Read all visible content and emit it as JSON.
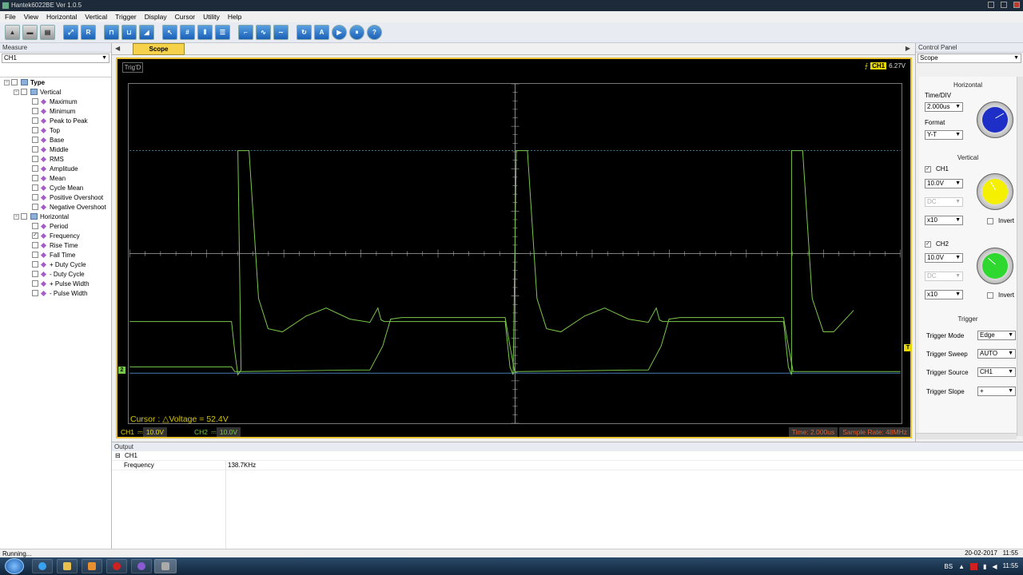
{
  "window": {
    "title": "Hantek6022BE Ver 1.0.5"
  },
  "menu": [
    "File",
    "View",
    "Horizontal",
    "Vertical",
    "Trigger",
    "Display",
    "Cursor",
    "Utility",
    "Help"
  ],
  "toolbar": {
    "buttons": [
      {
        "name": "open-icon",
        "glyph": "▲",
        "style": "grey"
      },
      {
        "name": "save-icon",
        "glyph": "▬",
        "style": "grey"
      },
      {
        "name": "print-icon",
        "glyph": "▤",
        "style": "grey"
      },
      {
        "sep": true
      },
      {
        "name": "auto-scale-icon",
        "glyph": "⤢"
      },
      {
        "name": "reset-icon",
        "glyph": "R"
      },
      {
        "sep": true
      },
      {
        "name": "single-trigger-icon",
        "glyph": "⊓"
      },
      {
        "name": "normal-trigger-icon",
        "glyph": "⊔"
      },
      {
        "name": "ramp-icon",
        "glyph": "◢"
      },
      {
        "sep": true
      },
      {
        "name": "cursor-select-icon",
        "glyph": "↖"
      },
      {
        "name": "grid-icon",
        "glyph": "#"
      },
      {
        "name": "vertical-cursor-icon",
        "glyph": "⫴"
      },
      {
        "name": "horizontal-cursor-icon",
        "glyph": "☰"
      },
      {
        "sep": true
      },
      {
        "name": "edge-trigger-icon",
        "glyph": "⌐"
      },
      {
        "name": "signal-icon",
        "glyph": "∿"
      },
      {
        "name": "sine-icon",
        "glyph": "∼"
      },
      {
        "sep": true
      },
      {
        "name": "refresh-icon",
        "glyph": "↻"
      },
      {
        "name": "auto-icon",
        "glyph": "A"
      },
      {
        "name": "play-icon",
        "glyph": "▶",
        "style": "round"
      },
      {
        "name": "pause-icon",
        "glyph": "⏸",
        "style": "round"
      },
      {
        "name": "help-icon",
        "glyph": "?",
        "style": "round"
      }
    ]
  },
  "measure": {
    "title": "Measure",
    "channel": "CH1",
    "tree_root": "Type",
    "groups": [
      {
        "label": "Vertical",
        "items": [
          {
            "label": "Maximum",
            "checked": false
          },
          {
            "label": "Minimum",
            "checked": false
          },
          {
            "label": "Peak to Peak",
            "checked": false
          },
          {
            "label": "Top",
            "checked": false
          },
          {
            "label": "Base",
            "checked": false
          },
          {
            "label": "Middle",
            "checked": false
          },
          {
            "label": "RMS",
            "checked": false
          },
          {
            "label": "Amplitude",
            "checked": false
          },
          {
            "label": "Mean",
            "checked": false
          },
          {
            "label": "Cycle Mean",
            "checked": false
          },
          {
            "label": "Positive Overshoot",
            "checked": false
          },
          {
            "label": "Negative Overshoot",
            "checked": false
          }
        ]
      },
      {
        "label": "Horizontal",
        "items": [
          {
            "label": "Period",
            "checked": false
          },
          {
            "label": "Frequency",
            "checked": true
          },
          {
            "label": "Rise Time",
            "checked": false
          },
          {
            "label": "Fall Time",
            "checked": false
          },
          {
            "label": "+ Duty Cycle",
            "checked": false
          },
          {
            "label": "- Duty Cycle",
            "checked": false
          },
          {
            "label": "+ Pulse Width",
            "checked": false
          },
          {
            "label": "- Pulse Width",
            "checked": false
          }
        ]
      }
    ]
  },
  "scope": {
    "tab": "Scope",
    "trig_status": "Trig'D",
    "trig_channel": "CH1",
    "trig_level": "6.27V",
    "cursor_text": "Cursor : △Voltage = 52.4V",
    "ch1_label": "CH1",
    "ch1_scale": "10.0V",
    "ch2_label": "CH2",
    "ch2_scale": "10.0V",
    "time_text": "Time: 2.000us",
    "sample_rate": "Sample Rate: 48MHz",
    "ch2_marker": "2",
    "trigger_marker": "T",
    "colors": {
      "ch1": "#d8d800",
      "ch2": "#5fc04a",
      "ch2_ref": "#4a7ab8",
      "frame": "#e8c030"
    }
  },
  "control": {
    "title": "Control Panel",
    "mode": "Scope",
    "horizontal": {
      "section": "Horizontal",
      "time_label": "Time/DIV",
      "time_value": "2.000us",
      "format_label": "Format",
      "format_value": "Y-T"
    },
    "vertical": {
      "section": "Vertical",
      "ch1": {
        "label": "CH1",
        "enabled": true,
        "volts": "10.0V",
        "coupling": "DC",
        "probe": "x10",
        "invert": "Invert"
      },
      "ch2": {
        "label": "CH2",
        "enabled": true,
        "volts": "10.0V",
        "coupling": "DC",
        "probe": "x10",
        "invert": "Invert"
      }
    },
    "trigger": {
      "section": "Trigger",
      "mode_label": "Trigger Mode",
      "mode_value": "Edge",
      "sweep_label": "Trigger Sweep",
      "sweep_value": "AUTO",
      "source_label": "Trigger Source",
      "source_value": "CH1",
      "slope_label": "Trigger Slope",
      "slope_value": "+"
    }
  },
  "output": {
    "title": "Output",
    "channel": "CH1",
    "rows": [
      {
        "name": "Frequency",
        "value": "138.7KHz"
      }
    ]
  },
  "status": {
    "text": "Running...",
    "date": "20-02-2017",
    "time": "11:55"
  },
  "taskbar": {
    "lang": "BS"
  }
}
